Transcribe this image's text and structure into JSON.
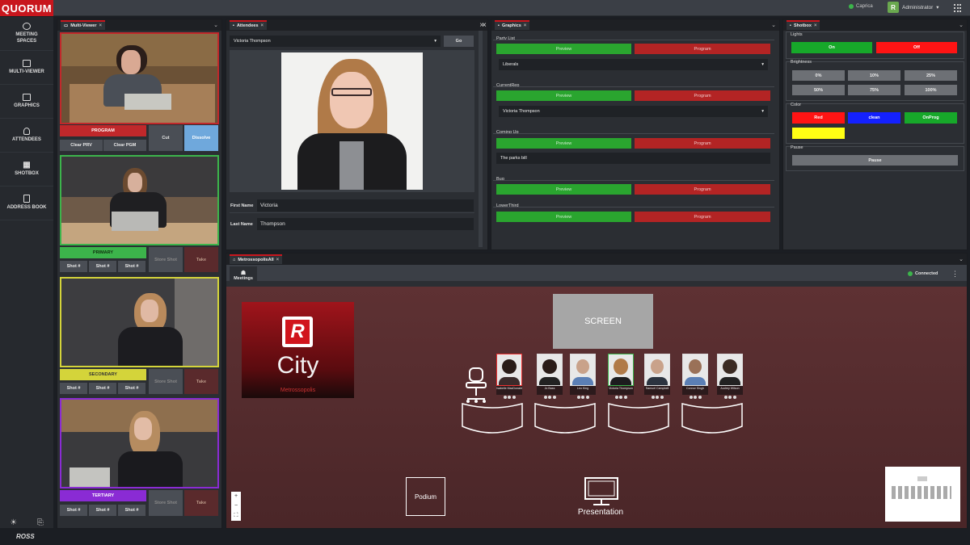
{
  "app": {
    "logo": "QUORUM",
    "status": "Caprica",
    "user_initial": "R",
    "user": "Administrator",
    "brand": "ROSS"
  },
  "nav": [
    {
      "label": "MEETING SPACES",
      "icon": "meeting-spaces-icon"
    },
    {
      "label": "MULTI-VIEWER",
      "icon": "monitor-icon"
    },
    {
      "label": "GRAPHICS",
      "icon": "graphics-icon"
    },
    {
      "label": "ATTENDEES",
      "icon": "person-icon"
    },
    {
      "label": "SHOTBOX",
      "icon": "grid-icon"
    },
    {
      "label": "ADDRESS BOOK",
      "icon": "address-book-icon"
    }
  ],
  "multiviewer": {
    "title": "Multi-Viewer",
    "program": {
      "label": "PROGRAM",
      "clear_prv": "Clear PRV",
      "clear_pgm": "Clear PGM",
      "cut": "Cut",
      "dissolve": "Dissolve"
    },
    "primary": {
      "label": "PRIMARY",
      "shot": "Shot #",
      "store": "Store Shot",
      "take": "Take"
    },
    "secondary": {
      "label": "SECONDARY",
      "shot": "Shot #",
      "store": "Store Shot",
      "take": "Take"
    },
    "tertiary": {
      "label": "TERTIARY",
      "shot": "Shot #",
      "store": "Store Shot",
      "take": "Take"
    },
    "colors": {
      "program": "#c0282b",
      "primary": "#3cb44b",
      "secondary": "#d4d43a",
      "tertiary": "#8a2bd4"
    }
  },
  "attendees": {
    "title": "Attendees",
    "selected": "Victoria Thompson",
    "go": "Go",
    "first_name_label": "First Name",
    "first_name": "Victoria",
    "last_name_label": "Last Name",
    "last_name": "Thompson"
  },
  "graphics": {
    "title": "Graphics",
    "preview": "Preview",
    "program": "Program",
    "sections": [
      {
        "name": "Party List",
        "value": "Liberals"
      },
      {
        "name": "CurrentRep",
        "value": "Victoria Thompson"
      },
      {
        "name": "Coming Up",
        "value": "The parks bill"
      },
      {
        "name": "Bug",
        "value": ""
      },
      {
        "name": "LowerThird",
        "value": ""
      }
    ]
  },
  "shotbox": {
    "title": "Shotbox",
    "lights": {
      "label": "Lights",
      "on": "On",
      "off": "Off"
    },
    "brightness": {
      "label": "Brightness",
      "values": [
        "0%",
        "10%",
        "25%",
        "50%",
        "75%",
        "100%"
      ]
    },
    "color": {
      "label": "Color",
      "values": [
        "Red",
        "clean",
        "OnProg",
        "Yellow"
      ]
    },
    "pause": {
      "label": "Pause",
      "button": "Pause"
    }
  },
  "meeting": {
    "tab": "MetrossopolisAll",
    "toolbar_label": "Meetings",
    "connection": "Connected",
    "logo_letter": "R",
    "city": "City",
    "city_sub": "Metrossopolis",
    "screen": "SCREEN",
    "podium": "Podium",
    "presentation": "Presentation",
    "zoom": [
      "+",
      "−",
      "⛶"
    ],
    "seats": [
      {
        "name": "Isabelle MacDonald"
      },
      {
        "name": "Jo Bass"
      },
      {
        "name": "Leo King"
      },
      {
        "name": "Victoria Thompson"
      },
      {
        "name": "Samuel Campbell"
      },
      {
        "name": "Connor Singh"
      },
      {
        "name": "Audrey Wilson"
      }
    ]
  }
}
